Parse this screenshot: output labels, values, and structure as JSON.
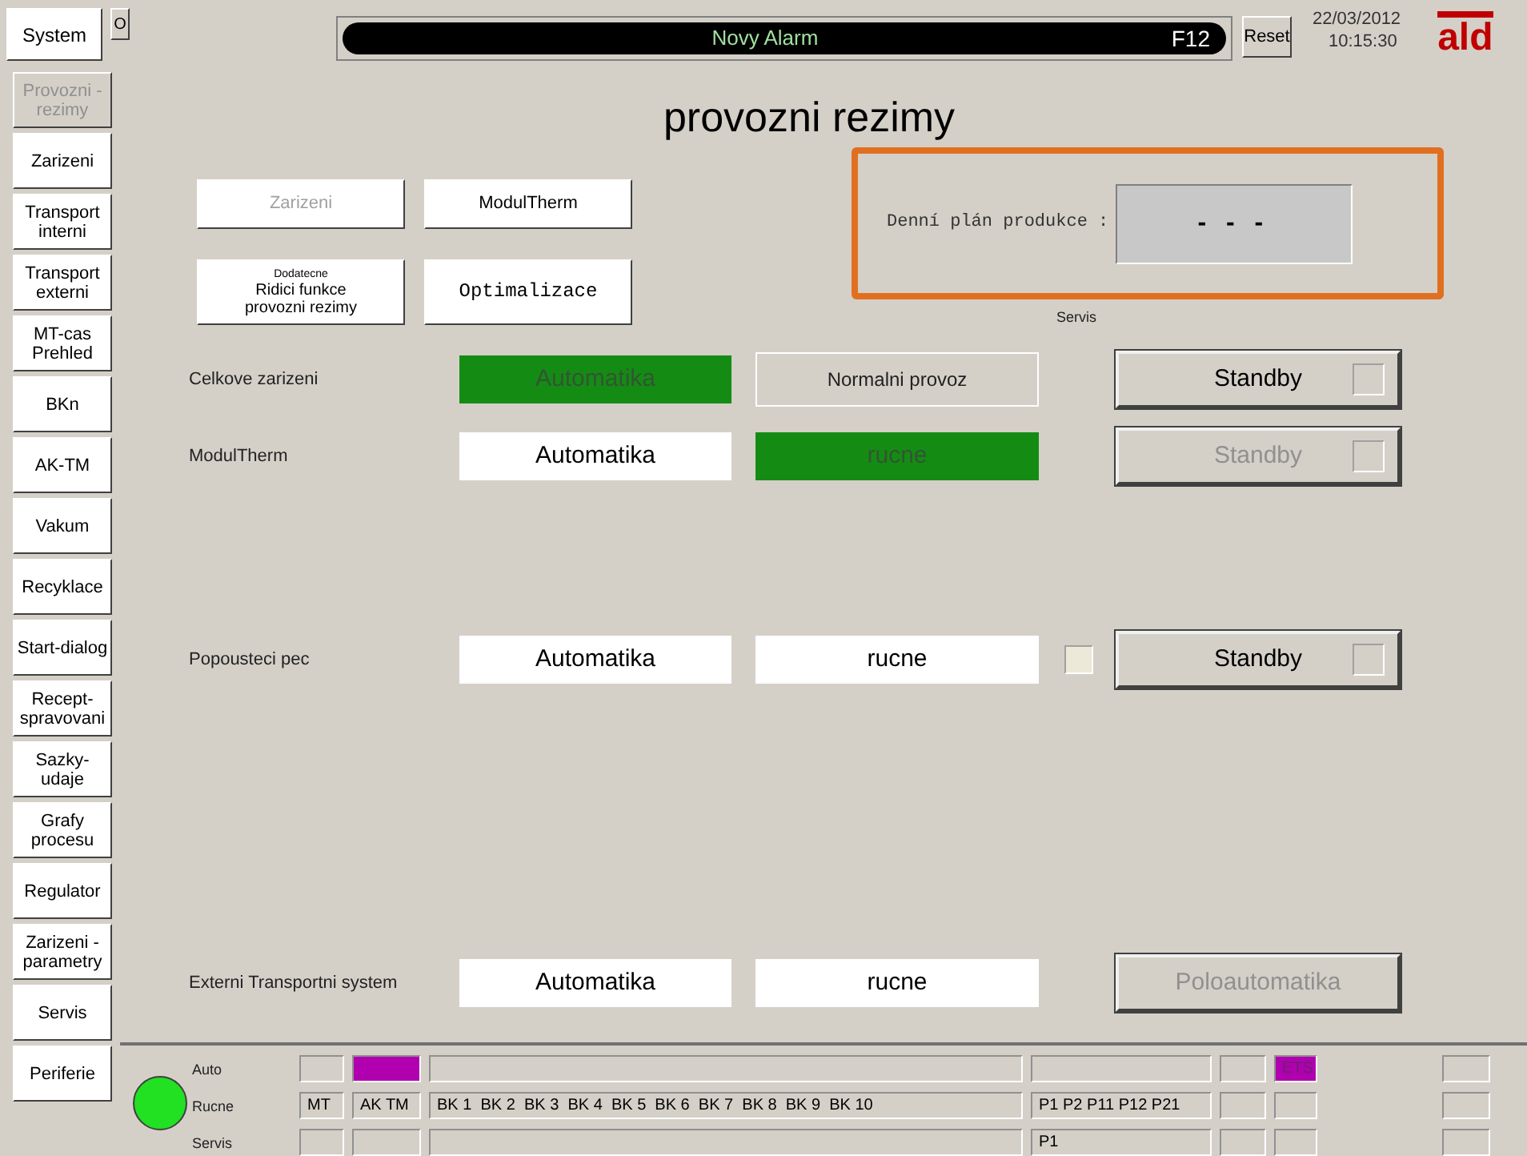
{
  "top_bar": {
    "system_button": "System",
    "o_button": "O",
    "alarm": {
      "text": "Novy Alarm",
      "key": "F12"
    },
    "reset_button": "Reset",
    "date": "22/03/2012",
    "time": "10:15:30",
    "logo": "ald"
  },
  "sidebar": {
    "items": [
      {
        "label": "Provozni - rezimy",
        "selected": true
      },
      {
        "label": "Zarizeni",
        "selected": false
      },
      {
        "label": "Transport interni",
        "selected": false
      },
      {
        "label": "Transport externi",
        "selected": false
      },
      {
        "label": "MT-cas Prehled",
        "selected": false
      },
      {
        "label": "BKn",
        "selected": false
      },
      {
        "label": "AK-TM",
        "selected": false
      },
      {
        "label": "Vakum",
        "selected": false
      },
      {
        "label": "Recyklace",
        "selected": false
      },
      {
        "label": "Start-dialog",
        "selected": false
      },
      {
        "label": "Recept-spravovani",
        "selected": false
      },
      {
        "label": "Sazky-udaje",
        "selected": false
      },
      {
        "label": "Grafy procesu",
        "selected": false
      },
      {
        "label": "Regulator",
        "selected": false
      },
      {
        "label": "Zarizeni - parametry",
        "selected": false
      },
      {
        "label": "Servis",
        "selected": false
      },
      {
        "label": "Periferie",
        "selected": false
      }
    ]
  },
  "panel": {
    "title": "provozni rezimy",
    "nav_buttons": [
      {
        "kind": "plain",
        "label": "Zarizeni",
        "disabled": true
      },
      {
        "kind": "plain",
        "label": "ModulTherm",
        "disabled": false
      },
      {
        "kind": "captioned",
        "caption": "Dodatecne",
        "label": "Ridici funkce provozni rezimy",
        "disabled": false
      },
      {
        "kind": "code",
        "label": "Optimalizace",
        "disabled": false
      }
    ],
    "production_plan": {
      "label": "Denní plán produkce :",
      "value": "- - -"
    },
    "servis_label": "Servis",
    "mode_rows": [
      {
        "label": "Celkove zarizeni",
        "auto": {
          "text": "Automatika",
          "active": true,
          "disabled": true
        },
        "manual": {
          "kind": "panel",
          "text": "Normalni provoz",
          "active": false,
          "disabled": false
        },
        "right": {
          "text": "Standby",
          "disabled": false,
          "checkbox": {
            "checked": false
          }
        }
      },
      {
        "label": "ModulTherm",
        "auto": {
          "text": "Automatika",
          "active": false,
          "disabled": false
        },
        "manual": {
          "kind": "toggle",
          "text": "rucne",
          "active": true,
          "disabled": true
        },
        "right": {
          "text": "Standby",
          "disabled": true,
          "checkbox": {
            "checked": false
          }
        }
      },
      {
        "label": "Popousteci pec",
        "auto": {
          "text": "Automatika",
          "active": false,
          "disabled": false
        },
        "manual": {
          "kind": "toggle",
          "text": "rucne",
          "active": false,
          "disabled": false
        },
        "indicator": {
          "checked": false
        },
        "right": {
          "text": "Standby",
          "disabled": false,
          "checkbox": {
            "checked": false
          }
        }
      },
      {
        "label": "Externi Transportni system",
        "auto": {
          "text": "Automatika",
          "active": false,
          "disabled": false
        },
        "manual": {
          "kind": "toggle",
          "text": "rucne",
          "active": false,
          "disabled": false
        },
        "right": {
          "text": "Poloautomatika",
          "disabled": true
        }
      }
    ]
  },
  "status": {
    "lamp": {
      "on": true
    },
    "rows": [
      {
        "label": "Auto",
        "cells": [
          {
            "active": false
          },
          {
            "active": true
          },
          {
            "active": false
          },
          {
            "active": false
          },
          {
            "active": false
          },
          {
            "text": "ETS",
            "active": true
          },
          {
            "active": false
          }
        ]
      },
      {
        "label": "Rucne",
        "cells": [
          {
            "text": "MT",
            "active": false
          },
          {
            "text": "AK TM",
            "active": false
          },
          {
            "text": "BK 1  BK 2  BK 3  BK 4  BK 5  BK 6  BK 7  BK 8  BK 9  BK 10",
            "active": false
          },
          {
            "text": "P1 P2 P11 P12 P21",
            "active": false
          },
          {
            "active": false
          },
          {
            "active": false
          },
          {
            "active": false
          }
        ]
      },
      {
        "label": "Servis",
        "cells": [
          {
            "active": false
          },
          {
            "active": false
          },
          {
            "active": false
          },
          {
            "text": "P1",
            "active": false
          },
          {
            "active": false
          },
          {
            "active": false
          },
          {
            "active": false
          }
        ]
      }
    ]
  }
}
